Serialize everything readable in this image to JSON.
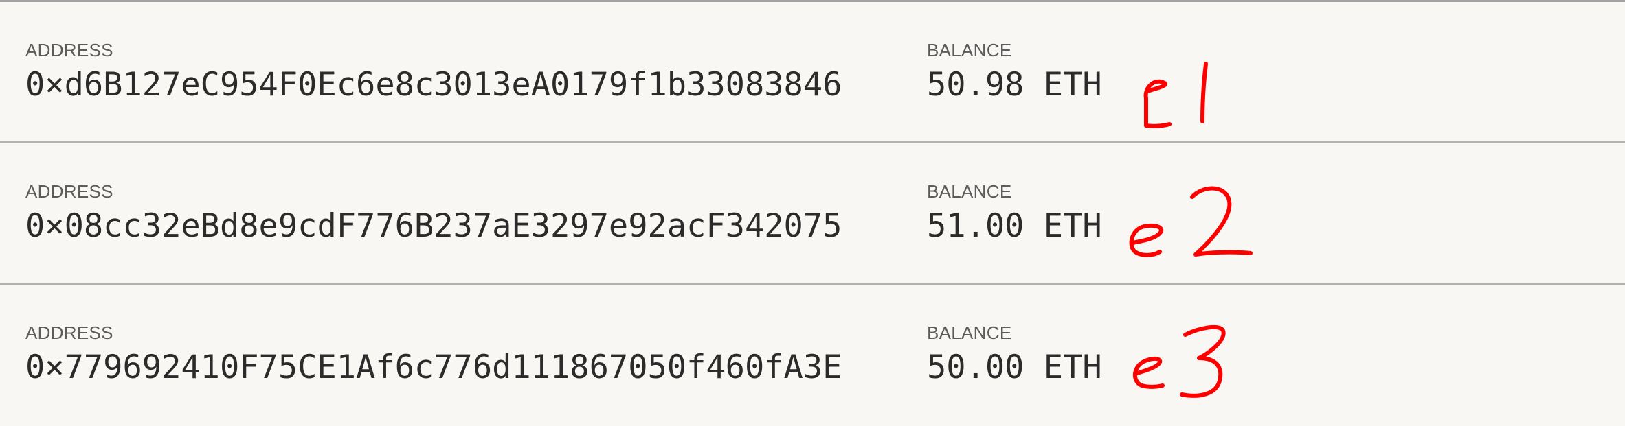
{
  "accounts": [
    {
      "address_label": "ADDRESS",
      "address": "0×d6B127eC954F0Ec6e8c3013eA0179f1b33083846",
      "balance_label": "BALANCE",
      "balance": "50.98 ETH",
      "annotation": "e1"
    },
    {
      "address_label": "ADDRESS",
      "address": "0×08cc32eBd8e9cdF776B237aE3297e92acF342075",
      "balance_label": "BALANCE",
      "balance": "51.00 ETH",
      "annotation": "e2"
    },
    {
      "address_label": "ADDRESS",
      "address": "0×779692410F75CE1Af6c776d111867050f460fA3E",
      "balance_label": "BALANCE",
      "balance": "50.00 ETH",
      "annotation": "e3"
    }
  ],
  "colors": {
    "background": "#f8f7f3",
    "annotation": "#ff0000",
    "label": "#5c5c5c",
    "value": "#2b2b2b"
  }
}
